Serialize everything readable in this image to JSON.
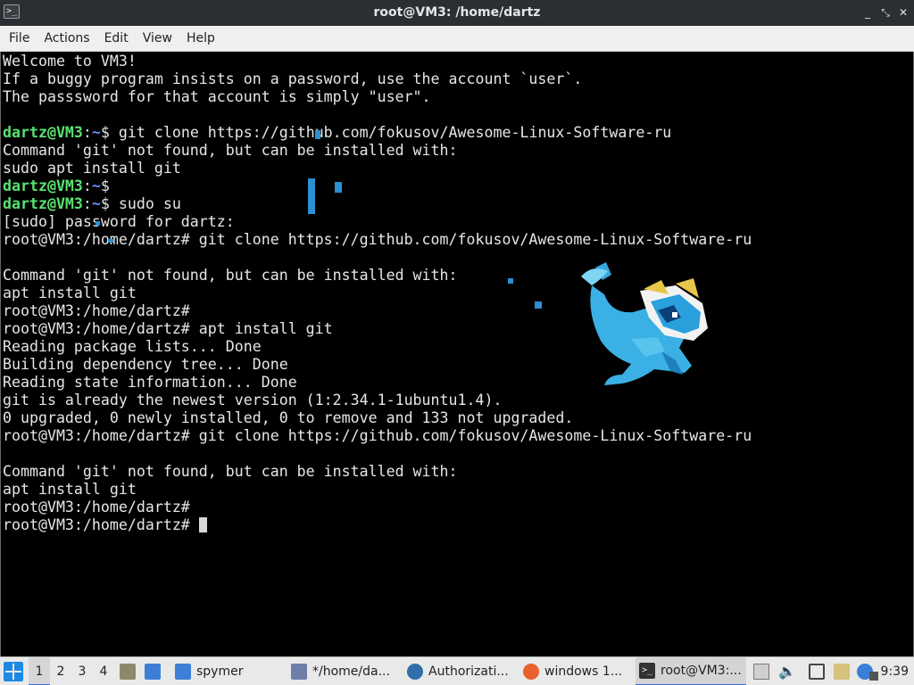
{
  "window": {
    "title": "root@VM3: /home/dartz",
    "app_icon": "terminal-icon",
    "buttons": {
      "minimize": "_",
      "maximize": "⤡",
      "close": "✕"
    }
  },
  "menu": [
    "File",
    "Actions",
    "Edit",
    "View",
    "Help"
  ],
  "terminal": {
    "lines": [
      [
        {
          "t": "Welcome to VM3!",
          "c": ""
        }
      ],
      [
        {
          "t": "If a buggy program insists on a password, use the account `user`.",
          "c": ""
        }
      ],
      [
        {
          "t": "The passsword for that account is simply \"user\".",
          "c": ""
        }
      ],
      [
        {
          "t": "",
          "c": ""
        }
      ],
      [
        {
          "t": "dartz@VM3",
          "c": "user"
        },
        {
          "t": ":",
          "c": ""
        },
        {
          "t": "~",
          "c": "path"
        },
        {
          "t": "$ git clone https://github.com/fokusov/Awesome-Linux-Software-ru",
          "c": ""
        }
      ],
      [
        {
          "t": "Command 'git' not found, but can be installed with:",
          "c": ""
        }
      ],
      [
        {
          "t": "sudo apt install git",
          "c": ""
        }
      ],
      [
        {
          "t": "dartz@VM3",
          "c": "user"
        },
        {
          "t": ":",
          "c": ""
        },
        {
          "t": "~",
          "c": "path"
        },
        {
          "t": "$",
          "c": ""
        }
      ],
      [
        {
          "t": "dartz@VM3",
          "c": "user"
        },
        {
          "t": ":",
          "c": ""
        },
        {
          "t": "~",
          "c": "path"
        },
        {
          "t": "$ sudo su",
          "c": ""
        }
      ],
      [
        {
          "t": "[sudo] password for dartz:",
          "c": ""
        }
      ],
      [
        {
          "t": "root@VM3:/home/dartz# git clone https://github.com/fokusov/Awesome-Linux-Software-ru",
          "c": ""
        }
      ],
      [
        {
          "t": "",
          "c": ""
        }
      ],
      [
        {
          "t": "Command 'git' not found, but can be installed with:",
          "c": ""
        }
      ],
      [
        {
          "t": "apt install git",
          "c": ""
        }
      ],
      [
        {
          "t": "root@VM3:/home/dartz#",
          "c": ""
        }
      ],
      [
        {
          "t": "root@VM3:/home/dartz# apt install git",
          "c": ""
        }
      ],
      [
        {
          "t": "Reading package lists... Done",
          "c": ""
        }
      ],
      [
        {
          "t": "Building dependency tree... Done",
          "c": ""
        }
      ],
      [
        {
          "t": "Reading state information... Done",
          "c": ""
        }
      ],
      [
        {
          "t": "git is already the newest version (1:2.34.1-1ubuntu1.4).",
          "c": ""
        }
      ],
      [
        {
          "t": "0 upgraded, 0 newly installed, 0 to remove and 133 not upgraded.",
          "c": ""
        }
      ],
      [
        {
          "t": "root@VM3:/home/dartz# git clone https://github.com/fokusov/Awesome-Linux-Software-ru",
          "c": ""
        }
      ],
      [
        {
          "t": "",
          "c": ""
        }
      ],
      [
        {
          "t": "Command 'git' not found, but can be installed with:",
          "c": ""
        }
      ],
      [
        {
          "t": "apt install git",
          "c": ""
        }
      ],
      [
        {
          "t": "root@VM3:/home/dartz#",
          "c": ""
        }
      ],
      [
        {
          "t": "root@VM3:/home/dartz# ",
          "c": "",
          "cursor": true
        }
      ]
    ]
  },
  "taskbar": {
    "start_icon": "start-menu-icon",
    "workspaces": [
      "1",
      "2",
      "3",
      "4"
    ],
    "active_workspace": "1",
    "tasks": [
      {
        "label": "spymer",
        "icon": "folder-icon",
        "color": "#3d7fd8",
        "active": false
      },
      {
        "label": "*/home/da...",
        "icon": "text-editor-icon",
        "color": "#6f7ea8",
        "active": false
      },
      {
        "label": "Authorizati...",
        "icon": "keepass-icon",
        "color": "#2f6ea8",
        "active": false
      },
      {
        "label": "windows 1...",
        "icon": "firefox-icon",
        "color": "#e8602c",
        "active": false
      },
      {
        "label": "root@VM3:...",
        "icon": "terminal-icon",
        "color": "#333333",
        "active": true
      }
    ],
    "tray": [
      "upload-icon",
      "volume-icon",
      "network-icon",
      "clipboard-icon",
      "notification-icon",
      "power-icon"
    ],
    "clock": "9:39"
  }
}
